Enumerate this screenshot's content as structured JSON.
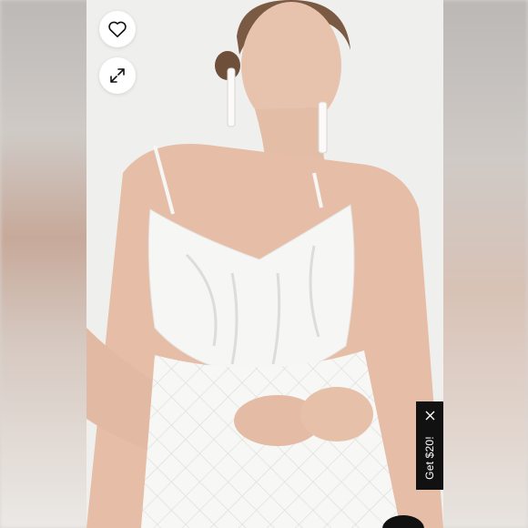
{
  "actions": {
    "like_icon": "heart-icon",
    "expand_icon": "expand-icon"
  },
  "promo": {
    "text": "Get $20!",
    "close_icon": "close-icon",
    "background": "#111111",
    "text_color": "#ffffff"
  }
}
